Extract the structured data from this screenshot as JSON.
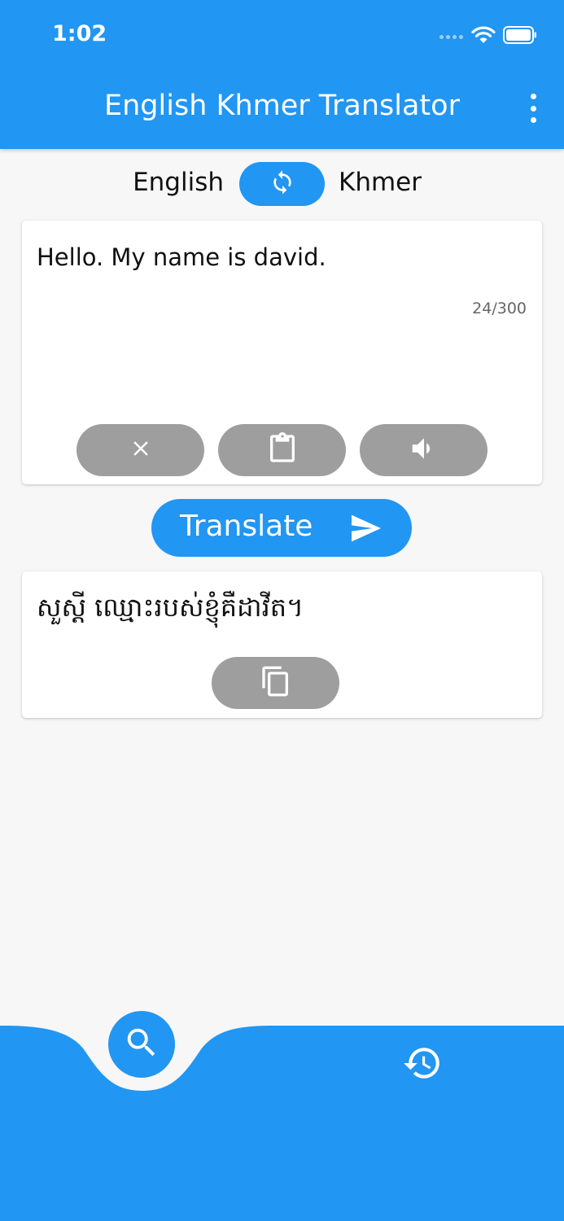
{
  "status_bar": {
    "time": "1:02"
  },
  "app_bar": {
    "title": "English Khmer Translator"
  },
  "languages": {
    "source": "English",
    "target": "Khmer"
  },
  "input": {
    "text": "Hello. My name is david.",
    "char_count": "24/300"
  },
  "translate_button": {
    "label": "Translate"
  },
  "output": {
    "text": "សួស្តី ឈ្មោះរបស់ខ្ញុំគឺដាវីត។"
  },
  "icons": {
    "swap": "sync-icon",
    "clear": "close-icon",
    "paste": "clipboard-icon",
    "speak": "speaker-icon",
    "send": "send-icon",
    "copy": "copy-icon",
    "search": "search-icon",
    "history": "history-icon",
    "menu": "more-vert-icon"
  },
  "colors": {
    "primary": "#2196f3",
    "pill": "#9e9e9e",
    "background": "#f7f7f7"
  }
}
